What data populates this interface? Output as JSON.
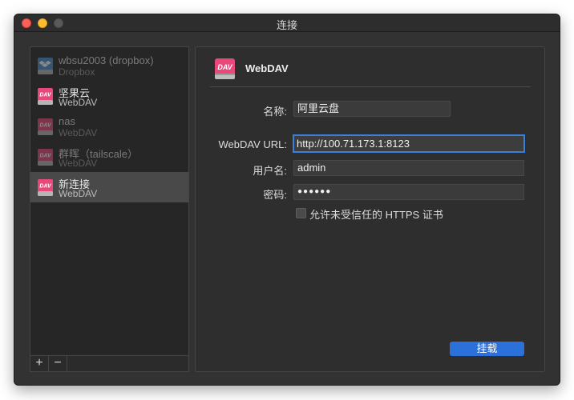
{
  "window": {
    "title": "连接"
  },
  "sidebar": {
    "connections": [
      {
        "name": "wbsu2003 (dropbox)",
        "type": "Dropbox",
        "icon": "dropbox-icon",
        "dimmed": true,
        "selected": false
      },
      {
        "name": "坚果云",
        "type": "WebDAV",
        "icon": "webdav-icon",
        "dimmed": false,
        "selected": false
      },
      {
        "name": "nas",
        "type": "WebDAV",
        "icon": "webdav-icon",
        "dimmed": true,
        "selected": false
      },
      {
        "name": "群晖（tailscale）",
        "type": "WebDAV",
        "icon": "webdav-icon",
        "dimmed": true,
        "selected": false
      },
      {
        "name": "新连接",
        "type": "WebDAV",
        "icon": "webdav-icon",
        "dimmed": false,
        "selected": true
      }
    ],
    "add_label": "+",
    "remove_label": "−"
  },
  "panel": {
    "icon": "webdav-icon",
    "icon_text": "DAV",
    "title": "WebDAV",
    "name_label": "名称:",
    "name_value": "阿里云盘",
    "url_label": "WebDAV URL:",
    "url_value": "http://100.71.173.1:8123",
    "username_label": "用户名:",
    "username_value": "admin",
    "password_label": "密码:",
    "password_value": "●●●●●●",
    "https_checkbox_label": "允许未受信任的 HTTPS 证书",
    "https_checked": false,
    "mount_label": "挂载"
  },
  "colors": {
    "accent": "#2b70db",
    "webdav_icon": "#e8487a",
    "dropbox_icon": "#4a8fd0"
  }
}
